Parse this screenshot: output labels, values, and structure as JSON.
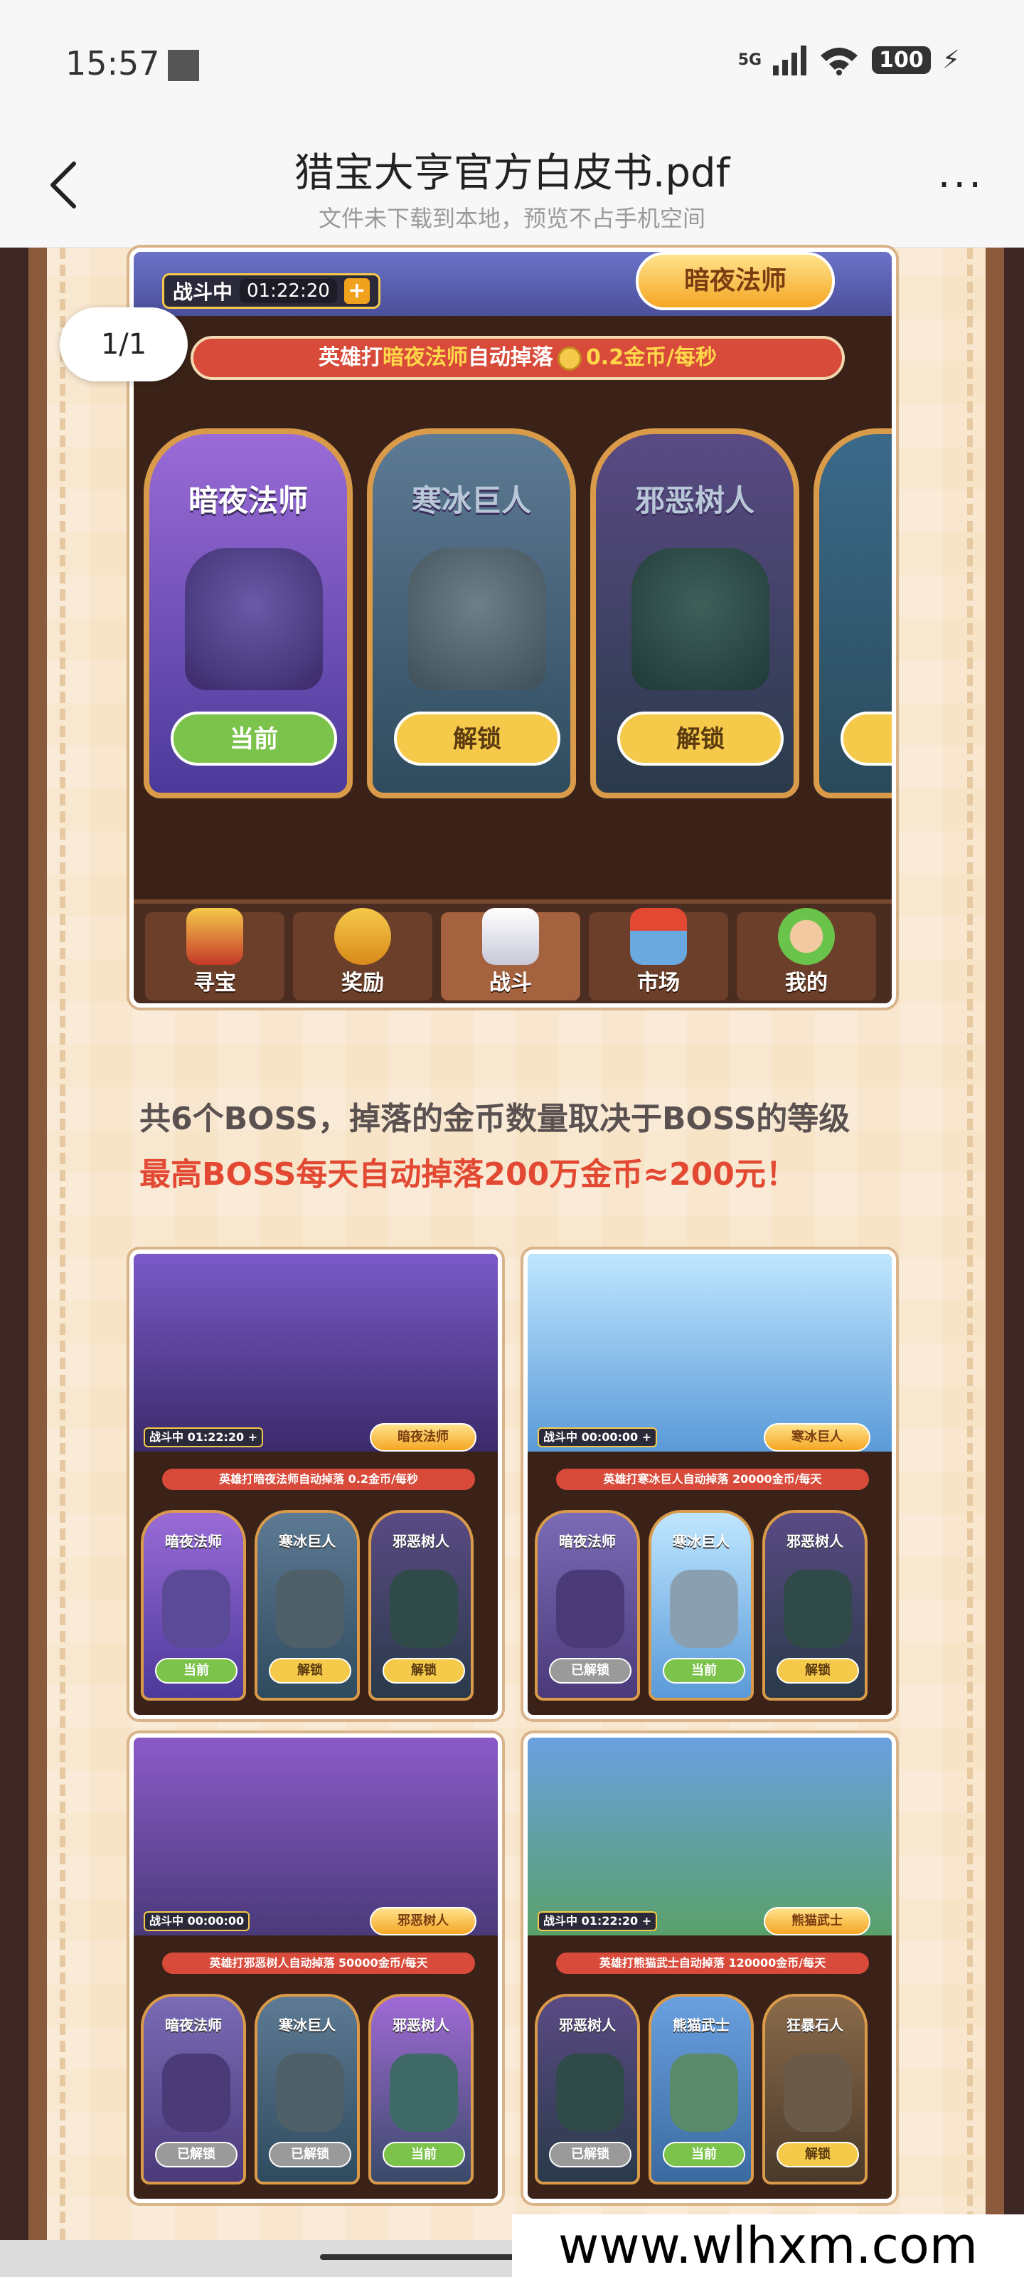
{
  "status_bar": {
    "time": "15:57",
    "network": "5G",
    "battery": "100",
    "charging_icon": "bolt-icon"
  },
  "header": {
    "title": "猎宝大亨官方白皮书.pdf",
    "subtitle": "文件未下载到本地，预览不占手机空间",
    "back_icon": "chevron-left-icon",
    "more_label": "···"
  },
  "page_indicator": "1/1",
  "game": {
    "battle_label": "战斗中",
    "battle_time": "01:22:20",
    "battle_plus": "+",
    "current_boss": "暗夜法师",
    "drop_prefix": "英雄打",
    "drop_boss": "暗夜法师",
    "drop_mid": "自动掉落",
    "drop_rate": "0.2金币/每秒",
    "cards": [
      {
        "name": "暗夜法师",
        "button": "当前"
      },
      {
        "name": "寒冰巨人",
        "button": "解锁"
      },
      {
        "name": "邪恶树人",
        "button": "解锁"
      },
      {
        "name": "",
        "button": ""
      }
    ],
    "nav": [
      {
        "label": "寻宝"
      },
      {
        "label": "奖励"
      },
      {
        "label": "战斗"
      },
      {
        "label": "市场"
      },
      {
        "label": "我的"
      }
    ]
  },
  "text": {
    "line1": "共6个BOSS，掉落的金币数量取决于BOSS的等级",
    "line2": "最高BOSS每天自动掉落200万金币≈200元！"
  },
  "thumbs": [
    {
      "pill": "战斗中 01:22:20 +",
      "name": "暗夜法师",
      "banner": "英雄打暗夜法师自动掉落 0.2金币/每秒",
      "cards": [
        {
          "name": "暗夜法师",
          "btn": "当前"
        },
        {
          "name": "寒冰巨人",
          "btn": "解锁"
        },
        {
          "name": "邪恶树人",
          "btn": "解锁"
        }
      ]
    },
    {
      "pill": "战斗中 00:00:00 +",
      "name": "寒冰巨人",
      "banner": "英雄打寒冰巨人自动掉落 20000金币/每天",
      "cards": [
        {
          "name": "暗夜法师",
          "btn": "已解锁"
        },
        {
          "name": "寒冰巨人",
          "btn": "当前"
        },
        {
          "name": "邪恶树人",
          "btn": "解锁"
        }
      ]
    },
    {
      "pill": "战斗中 00:00:00",
      "name": "邪恶树人",
      "banner": "英雄打邪恶树人自动掉落 50000金币/每天",
      "cards": [
        {
          "name": "暗夜法师",
          "btn": "已解锁"
        },
        {
          "name": "寒冰巨人",
          "btn": "已解锁"
        },
        {
          "name": "邪恶树人",
          "btn": "当前"
        }
      ]
    },
    {
      "pill": "战斗中 01:22:20 +",
      "name": "熊猫武士",
      "banner": "英雄打熊猫武士自动掉落 120000金币/每天",
      "cards": [
        {
          "name": "邪恶树人",
          "btn": "已解锁"
        },
        {
          "name": "熊猫武士",
          "btn": "当前"
        },
        {
          "name": "狂暴石人",
          "btn": "解锁"
        }
      ]
    }
  ],
  "watermark": "www.wlhxm.com"
}
